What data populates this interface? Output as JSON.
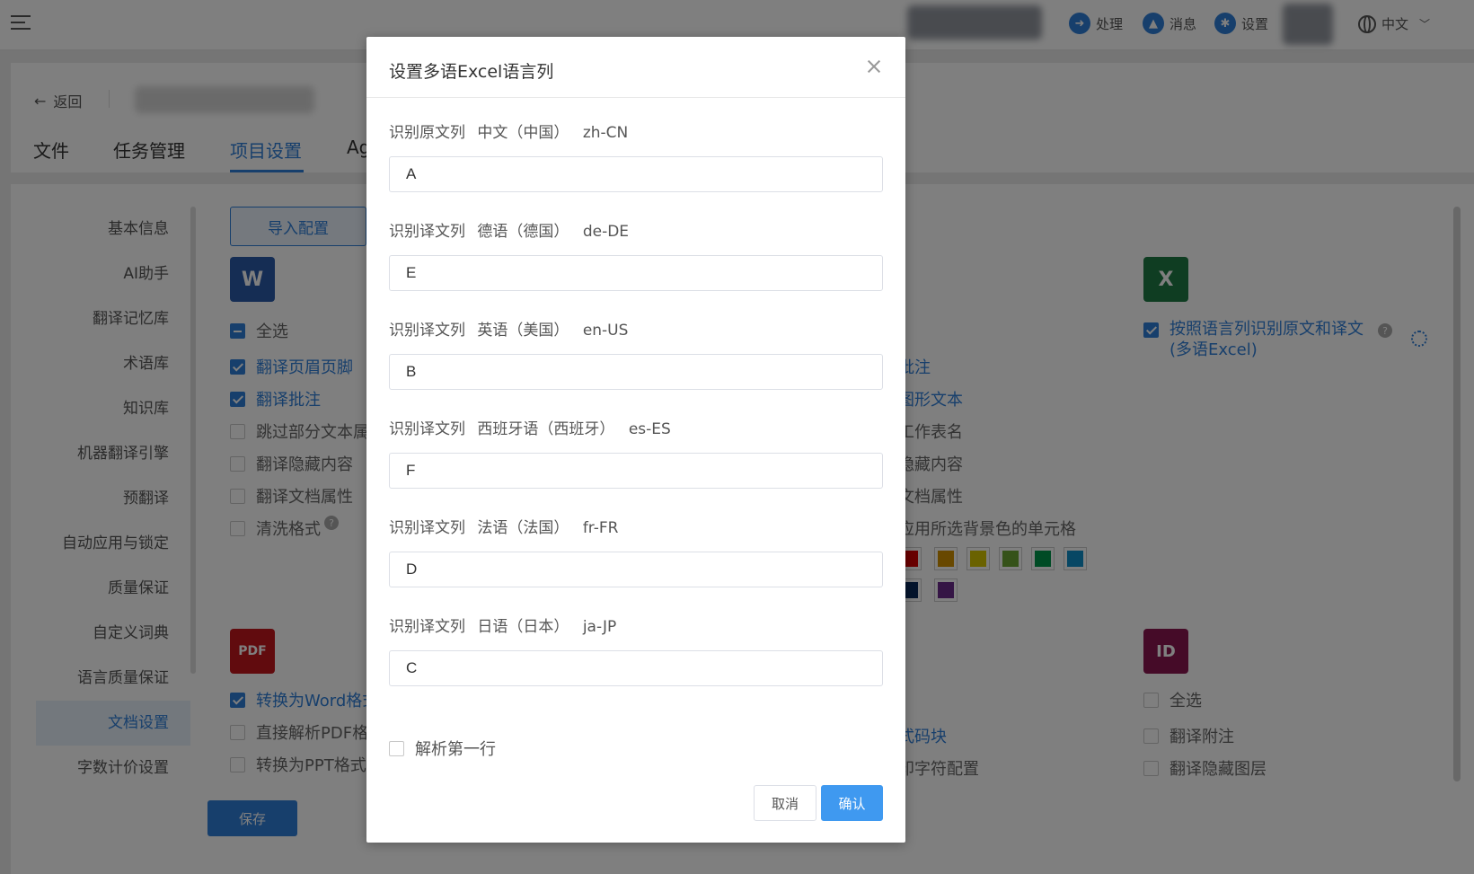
{
  "topbar": {
    "process_label": "处理",
    "message_label": "消息",
    "settings_label": "设置",
    "language_label": "中文"
  },
  "header": {
    "back_label": "返回",
    "tabs": [
      {
        "label": "文件"
      },
      {
        "label": "任务管理"
      },
      {
        "label": "项目设置"
      },
      {
        "label": "Ag"
      }
    ]
  },
  "sidebar": {
    "items": [
      {
        "label": "基本信息"
      },
      {
        "label": "AI助手"
      },
      {
        "label": "翻译记忆库"
      },
      {
        "label": "术语库"
      },
      {
        "label": "知识库"
      },
      {
        "label": "机器翻译引擎"
      },
      {
        "label": "预翻译"
      },
      {
        "label": "自动应用与锁定"
      },
      {
        "label": "质量保证"
      },
      {
        "label": "自定义词典"
      },
      {
        "label": "语言质量保证"
      },
      {
        "label": "文档设置"
      },
      {
        "label": "字数计价设置"
      }
    ]
  },
  "main": {
    "import_label": "导入配置",
    "save_label": "保存",
    "word_icon": "W",
    "excel_icon": "X",
    "pdf_icon": "PDF",
    "indesign_icon": "ID",
    "word_options": [
      {
        "label": "全选"
      },
      {
        "label": "翻译页眉页脚"
      },
      {
        "label": "翻译批注"
      },
      {
        "label": "跳过部分文本属"
      },
      {
        "label": "翻译隐藏内容"
      },
      {
        "label": "翻译文档属性"
      },
      {
        "label": "清洗格式"
      }
    ],
    "excel_middle_options": [
      {
        "label": "批注"
      },
      {
        "label": "图形文本"
      },
      {
        "label": "工作表名"
      },
      {
        "label": "隐藏内容"
      },
      {
        "label": "文档属性"
      },
      {
        "label": "应用所选背景色的单元格"
      }
    ],
    "excel_multilang_label": "按照语言列识别原文和译文(多语Excel)",
    "pdf_options": [
      {
        "label": "转换为Word格式"
      },
      {
        "label": "直接解析PDF格"
      },
      {
        "label": "转换为PPT格式"
      }
    ],
    "pdf_middle_options": [
      {
        "label": "式码块"
      },
      {
        "label": "印字符配置"
      }
    ],
    "indesign_options": [
      {
        "label": "全选"
      },
      {
        "label": "翻译附注"
      },
      {
        "label": "翻译隐藏图层"
      }
    ],
    "colors": [
      "#d40000",
      "#d09000",
      "#d4c400",
      "#6aa532",
      "#00964a",
      "#0f8fc8",
      "#0a2a5a",
      "#6a2a8a"
    ]
  },
  "dialog": {
    "title": "设置多语Excel语言列",
    "fields": [
      {
        "label": "识别原文列",
        "lang": "中文（中国）",
        "code": "zh-CN",
        "value": "A"
      },
      {
        "label": "识别译文列",
        "lang": "德语（德国）",
        "code": "de-DE",
        "value": "E"
      },
      {
        "label": "识别译文列",
        "lang": "英语（美国）",
        "code": "en-US",
        "value": "B"
      },
      {
        "label": "识别译文列",
        "lang": "西班牙语（西班牙）",
        "code": "es-ES",
        "value": "F"
      },
      {
        "label": "识别译文列",
        "lang": "法语（法国）",
        "code": "fr-FR",
        "value": "D"
      },
      {
        "label": "识别译文列",
        "lang": "日语（日本）",
        "code": "ja-JP",
        "value": "C"
      }
    ],
    "parse_first_row_label": "解析第一行",
    "cancel_label": "取消",
    "confirm_label": "确认"
  }
}
